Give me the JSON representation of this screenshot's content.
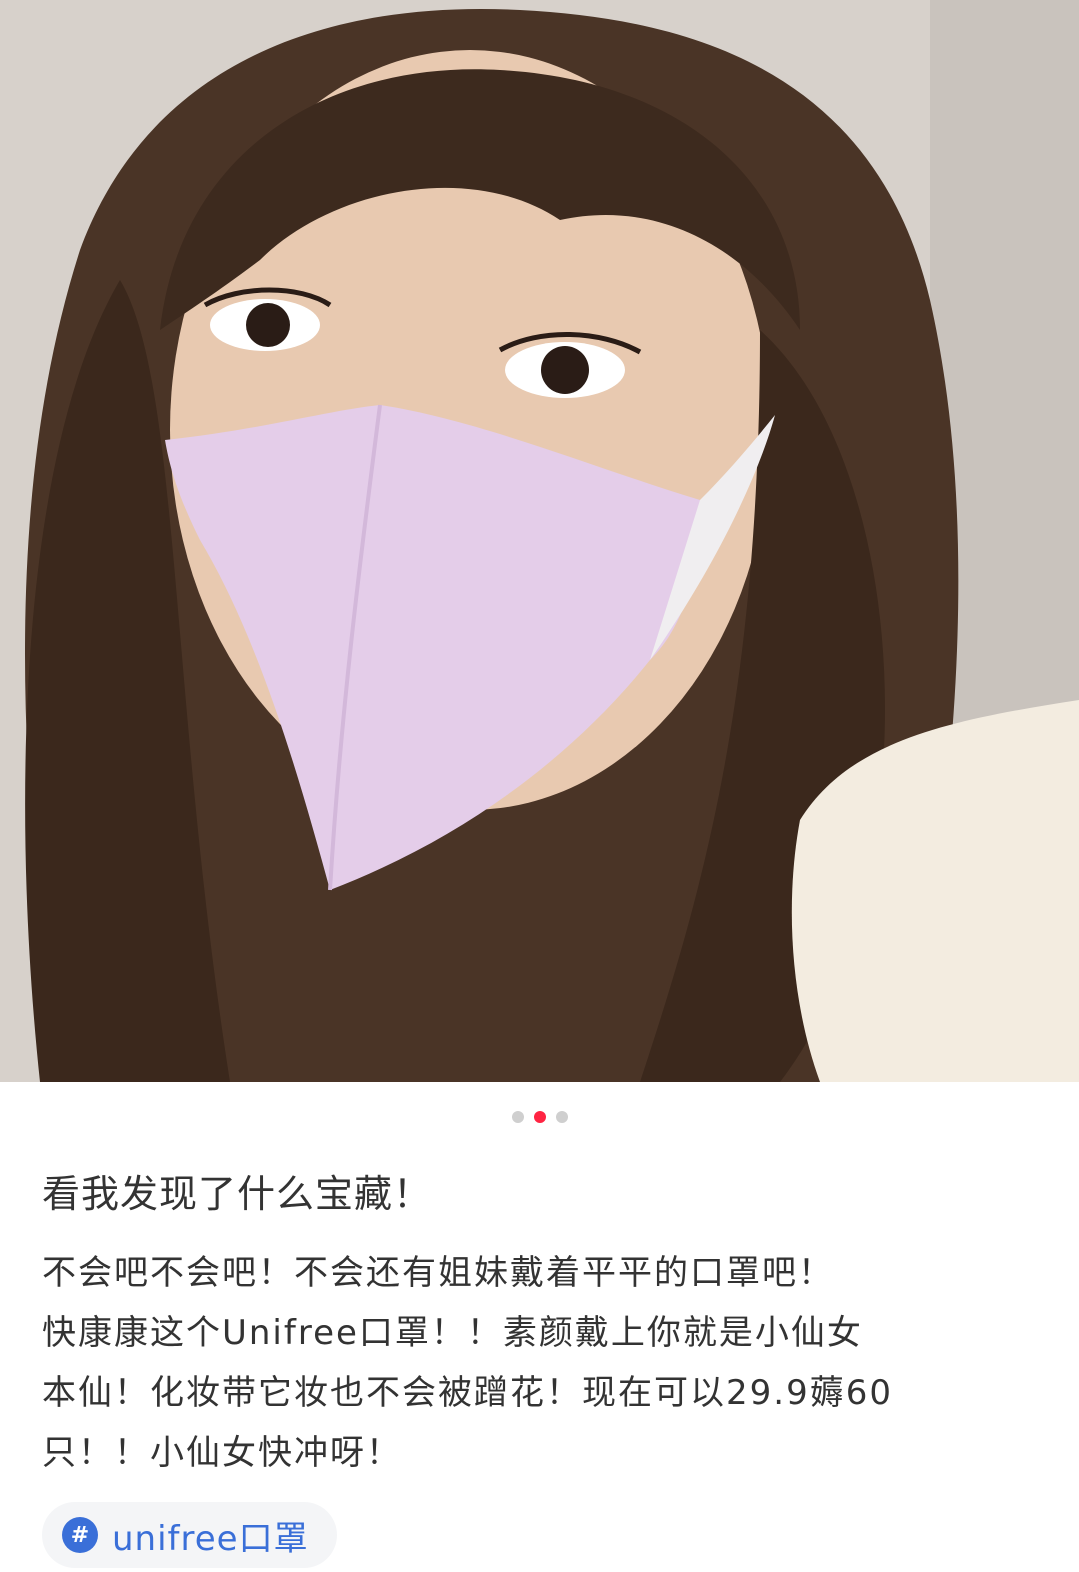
{
  "carousel": {
    "total": 3,
    "active_index": 2
  },
  "post": {
    "title": "看我发现了什么宝藏！",
    "body_lines": [
      "不会吧不会吧！不会还有姐妹戴着平平的口罩吧！",
      "快康康这个Unifree口罩！！素颜戴上你就是小仙女",
      "本仙！化妆带它妆也不会被蹭花！现在可以29.9薅60",
      "只！！小仙女快冲呀！"
    ]
  },
  "tag": {
    "icon": "hashtag-icon",
    "label": "unifree口罩"
  },
  "colors": {
    "accent_dot": "#ff2442",
    "tag_blue": "#3a6fd8",
    "tag_bg": "#f4f5f7"
  }
}
